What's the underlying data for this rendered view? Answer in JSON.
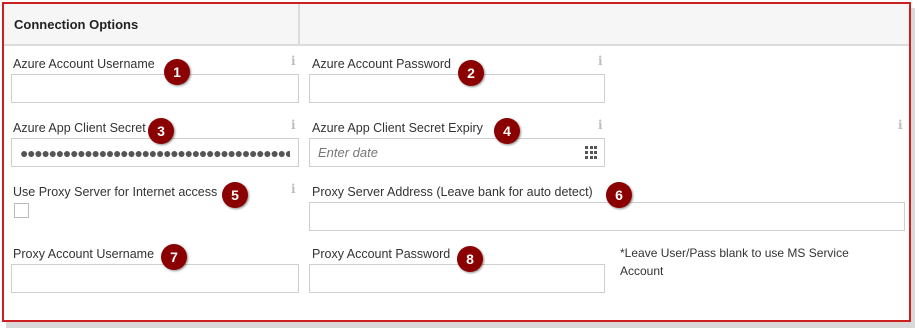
{
  "panel": {
    "title": "Connection Options"
  },
  "fields": {
    "azure_username": {
      "label": "Azure Account Username",
      "value": "",
      "badge": "1"
    },
    "azure_password": {
      "label": "Azure Account Password",
      "value": "",
      "badge": "2"
    },
    "client_secret": {
      "label": "Azure App Client Secret",
      "value": "●●●●●●●●●●●●●●●●●●●●●●●●●●●●●●●●●●●●●●●●●",
      "badge": "3"
    },
    "client_secret_expiry": {
      "label": "Azure App Client Secret Expiry",
      "placeholder": "Enter date",
      "badge": "4"
    },
    "use_proxy": {
      "label": "Use Proxy Server for Internet access",
      "checked": false,
      "badge": "5"
    },
    "proxy_address": {
      "label": "Proxy Server Address (Leave bank for auto detect)",
      "value": "",
      "badge": "6"
    },
    "proxy_username": {
      "label": "Proxy Account Username",
      "value": "",
      "badge": "7"
    },
    "proxy_password": {
      "label": "Proxy Account Password",
      "value": "",
      "badge": "8"
    }
  },
  "note": "*Leave User/Pass blank to use MS Service Account",
  "info_glyph": "i",
  "colors": {
    "frame_border": "#cc1f1f",
    "badge": "#8b0000"
  },
  "icons": {
    "info": "info-icon",
    "calendar": "calendar-grid-icon"
  }
}
